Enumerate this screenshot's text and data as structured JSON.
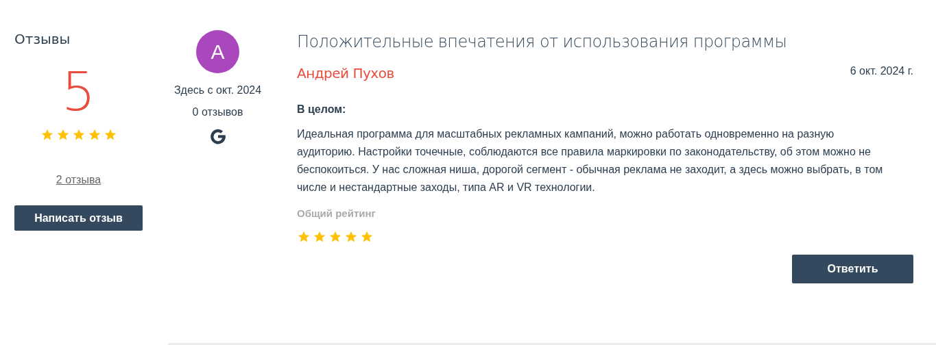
{
  "summary": {
    "title": "Отзывы",
    "score": "5",
    "stars": 5,
    "reviews_link": "2 отзыва",
    "write_button": "Написать отзыв"
  },
  "reviewer": {
    "initial": "А",
    "color": "#ab47bc",
    "since": "Здесь с окт. 2024",
    "reviews_count": "0 отзывов"
  },
  "review": {
    "title": "Положительные впечатения от использования программы",
    "author": "Андрей Пухов",
    "date": "6 окт. 2024 г.",
    "section_label": "В целом:",
    "text": "Идеальная программа для масштабных рекламных кампаний, можно работать одновременно на разную аудиторию. Настройки точечные, соблюдаются все правила маркировки по законодательству, об этом можно не беспокоиться. У нас сложная ниша, дорогой сегмент - обычная реклама не заходит, а здесь можно выбрать, в том числе и нестандартные заходы, типа AR и VR технологии.",
    "rating_label": "Общий рейтинг",
    "stars": 5,
    "reply_button": "Ответить"
  }
}
